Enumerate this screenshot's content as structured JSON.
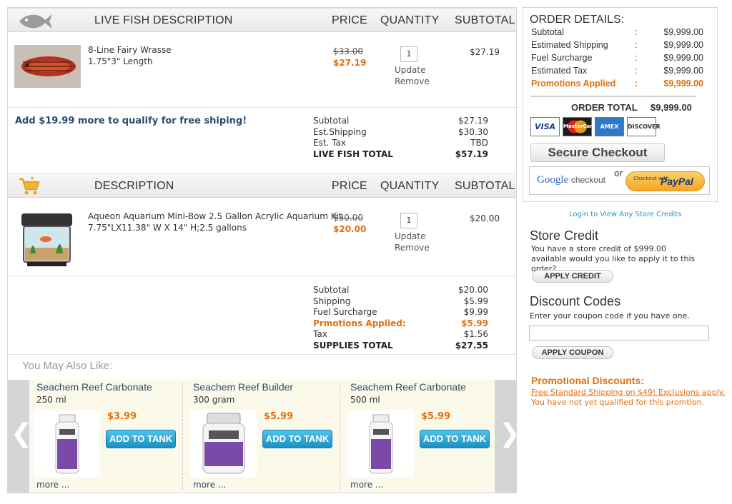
{
  "live_section": {
    "headers": {
      "description": "LIVE FISH DESCRIPTION",
      "price": "PRICE",
      "quantity": "QUANTITY",
      "subtotal": "SUBTOTAL"
    },
    "item": {
      "name": "8-Line Fairy Wrasse",
      "size": "1.75\"3\" Length",
      "old_price": "$33.00",
      "price": "$27.19",
      "qty": "1",
      "update": "Update",
      "remove": "Remove",
      "subtotal": "$27.19"
    },
    "free_ship_msg": "Add $19.99 more to qualify for free shiping!",
    "totals": [
      {
        "label": "Subtotal",
        "value": "$27.19",
        "style": ""
      },
      {
        "label": "Est.Shipping",
        "value": "$30.30",
        "style": ""
      },
      {
        "label": "Est. Tax",
        "value": "TBD",
        "style": ""
      },
      {
        "label": "LIVE FISH TOTAL",
        "value": "$57.19",
        "style": "b"
      }
    ]
  },
  "supplies_section": {
    "headers": {
      "description": "DESCRIPTION",
      "price": "PRICE",
      "quantity": "QUANTITY",
      "subtotal": "SUBTOTAL"
    },
    "item": {
      "name": "Aqueon Aquarium Mini-Bow 2.5 Gallon Acrylic Aquarium Kit",
      "size": "7.75\"LX11.38\" W X 14\" H;2.5 gallons",
      "old_price": "$30.00",
      "price": "$20.00",
      "qty": "1",
      "update": "Update",
      "remove": "Remove",
      "subtotal": "$20.00"
    },
    "totals": [
      {
        "label": "Subtotal",
        "value": "$20.00",
        "style": ""
      },
      {
        "label": "Shipping",
        "value": "$5.99",
        "style": ""
      },
      {
        "label": "Fuel Surcharge",
        "value": "$9.99",
        "style": ""
      },
      {
        "label": "Prmotions Applied:",
        "value": "$5.99",
        "style": "o"
      },
      {
        "label": "Tax",
        "value": "$1.56",
        "style": ""
      },
      {
        "label": "SUPPLIES TOTAL",
        "value": "$27.55",
        "style": "b"
      }
    ]
  },
  "you_may_also_like": {
    "title": "You May Also Like:",
    "products": [
      {
        "name": "Seachem Reef Carbonate",
        "size": "250 ml",
        "price": "$3.99",
        "button": "ADD TO TANK",
        "more": "more ..."
      },
      {
        "name": "Seachem Reef Builder",
        "size": "300 gram",
        "price": "$5.99",
        "button": "ADD TO TANK",
        "more": "more ..."
      },
      {
        "name": "Seachem Reef Carbonate",
        "size": "500 ml",
        "price": "$5.99",
        "button": "ADD TO TANK",
        "more": "more ..."
      }
    ],
    "prev_icon": "chevron-left-icon",
    "next_icon": "chevron-right-icon"
  },
  "order_details": {
    "title": "ORDER DETAILS:",
    "rows": [
      {
        "label": "Subtotal",
        "sep": ":",
        "value": "$9,999.00"
      },
      {
        "label": "Estimated Shipping",
        "sep": ":",
        "value": "$9,999.00"
      },
      {
        "label": "Fuel Surcharge",
        "sep": ":",
        "value": "$9,999.00"
      },
      {
        "label": "Estimated Tax",
        "sep": ":",
        "value": "$9,999.00"
      },
      {
        "label": "Promotions Applied",
        "sep": ":",
        "value": "$9,999.00"
      }
    ],
    "total_label": "ORDER TOTAL",
    "total_value": "$9,999.00",
    "cards": [
      "VISA",
      "MasterCard",
      "AMEX",
      "DISCOVER"
    ],
    "secure_checkout": "Secure Checkout",
    "google_checkout": {
      "google": "Google",
      "checkout": "checkout"
    },
    "or": "or",
    "paypal": {
      "small": "Checkout with",
      "brand": "PayPal"
    }
  },
  "store_credit": {
    "login_link": "Login to View Any Store Credits",
    "title": "Store Credit",
    "text": "You have a store credit of $999.00 available would you like to apply it to this order?",
    "button": "APPLY CREDIT"
  },
  "discount": {
    "title": "Discount Codes",
    "text": "Enter your coupon code if you have one.",
    "placeholder": "",
    "button": "APPLY COUPON"
  },
  "promotional": {
    "title": "Promotional Discounts:",
    "link": "Free Standard Shipping on $49! Exclusions apply.",
    "note": "You have not yet qualified for this promtion."
  },
  "colors": {
    "accent_orange": "#e2700f",
    "link_blue": "#2a4b6e",
    "button_blue": "#1a8fc4"
  }
}
